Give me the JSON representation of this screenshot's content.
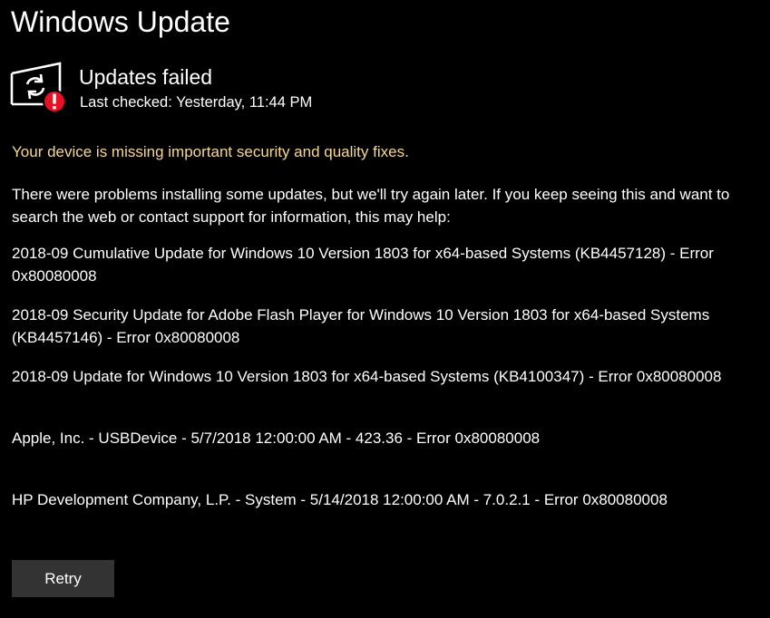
{
  "page": {
    "title": "Windows Update"
  },
  "status": {
    "icon": "sync-error-icon",
    "title": "Updates failed",
    "last_checked": "Last checked: Yesterday, 11:44 PM"
  },
  "warning": {
    "text": "Your device is missing important security and quality fixes.",
    "color": "#f7d794"
  },
  "intro": {
    "text": "There were problems installing some updates, but we'll try again later. If you keep seeing this and want to search the web or contact support for information, this may help:"
  },
  "failed_updates": [
    "2018-09 Cumulative Update for Windows 10 Version 1803 for x64-based Systems (KB4457128) - Error 0x80080008",
    "2018-09 Security Update for Adobe Flash Player for Windows 10 Version 1803 for x64-based Systems (KB4457146) - Error 0x80080008",
    "2018-09 Update for Windows 10 Version 1803 for x64-based Systems (KB4100347) - Error 0x80080008",
    "Apple, Inc. - USBDevice - 5/7/2018 12:00:00 AM - 423.36 - Error 0x80080008",
    "HP Development Company, L.P. - System - 5/14/2018 12:00:00 AM - 7.0.2.1 - Error 0x80080008"
  ],
  "actions": {
    "retry_label": "Retry"
  },
  "colors": {
    "background": "#000000",
    "text": "#ffffff",
    "error_badge": "#e81123",
    "button": "#333333"
  }
}
